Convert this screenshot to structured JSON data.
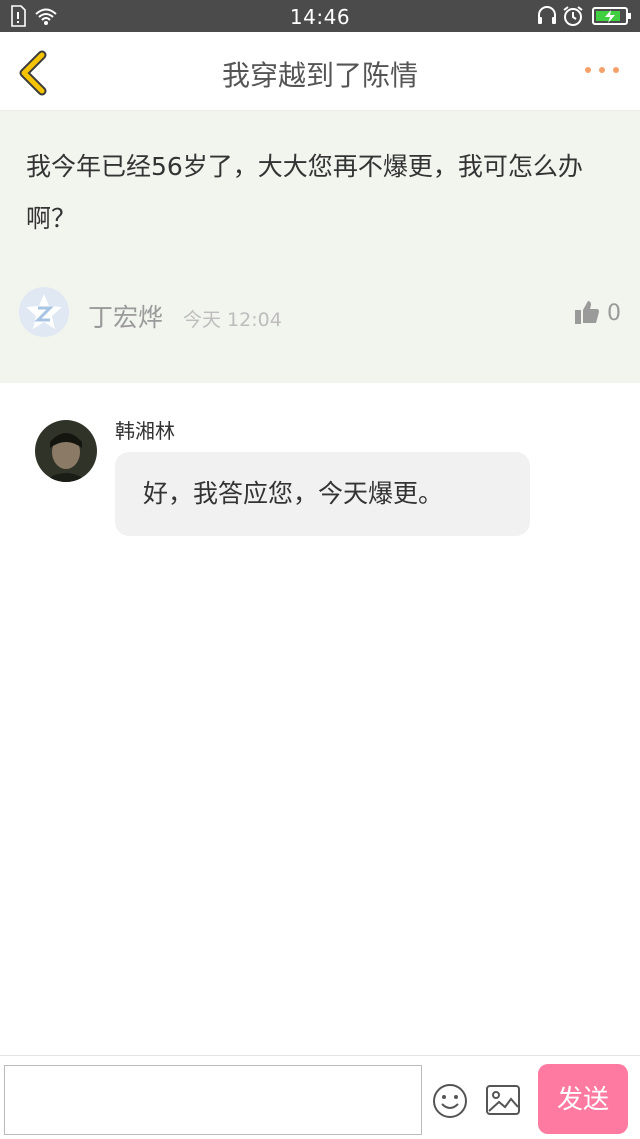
{
  "status_bar": {
    "time": "14:46",
    "icons": [
      "sim-icon",
      "wifi-icon",
      "headset-icon",
      "alarm-icon",
      "battery-charging-icon"
    ]
  },
  "header": {
    "title": "我穿越到了陈情",
    "back_icon": "chevron-left-icon",
    "more_icon": "more-dots-icon"
  },
  "post": {
    "text": "我今年已经56岁了，大大您再不爆更，我可怎么办啊？",
    "author": "丁宏烨",
    "time": "今天 12:04",
    "likes": "0"
  },
  "reply": {
    "author": "韩湘林",
    "text": "好，我答应您，今天爆更。"
  },
  "composer": {
    "placeholder": "",
    "send_label": "发送"
  },
  "colors": {
    "accent_yellow": "#f5c400",
    "more_dots": "#f6a06a",
    "send_pink": "#ff7aa0",
    "post_bg": "#f2f4ee",
    "status_bar": "#4b4b4b"
  }
}
